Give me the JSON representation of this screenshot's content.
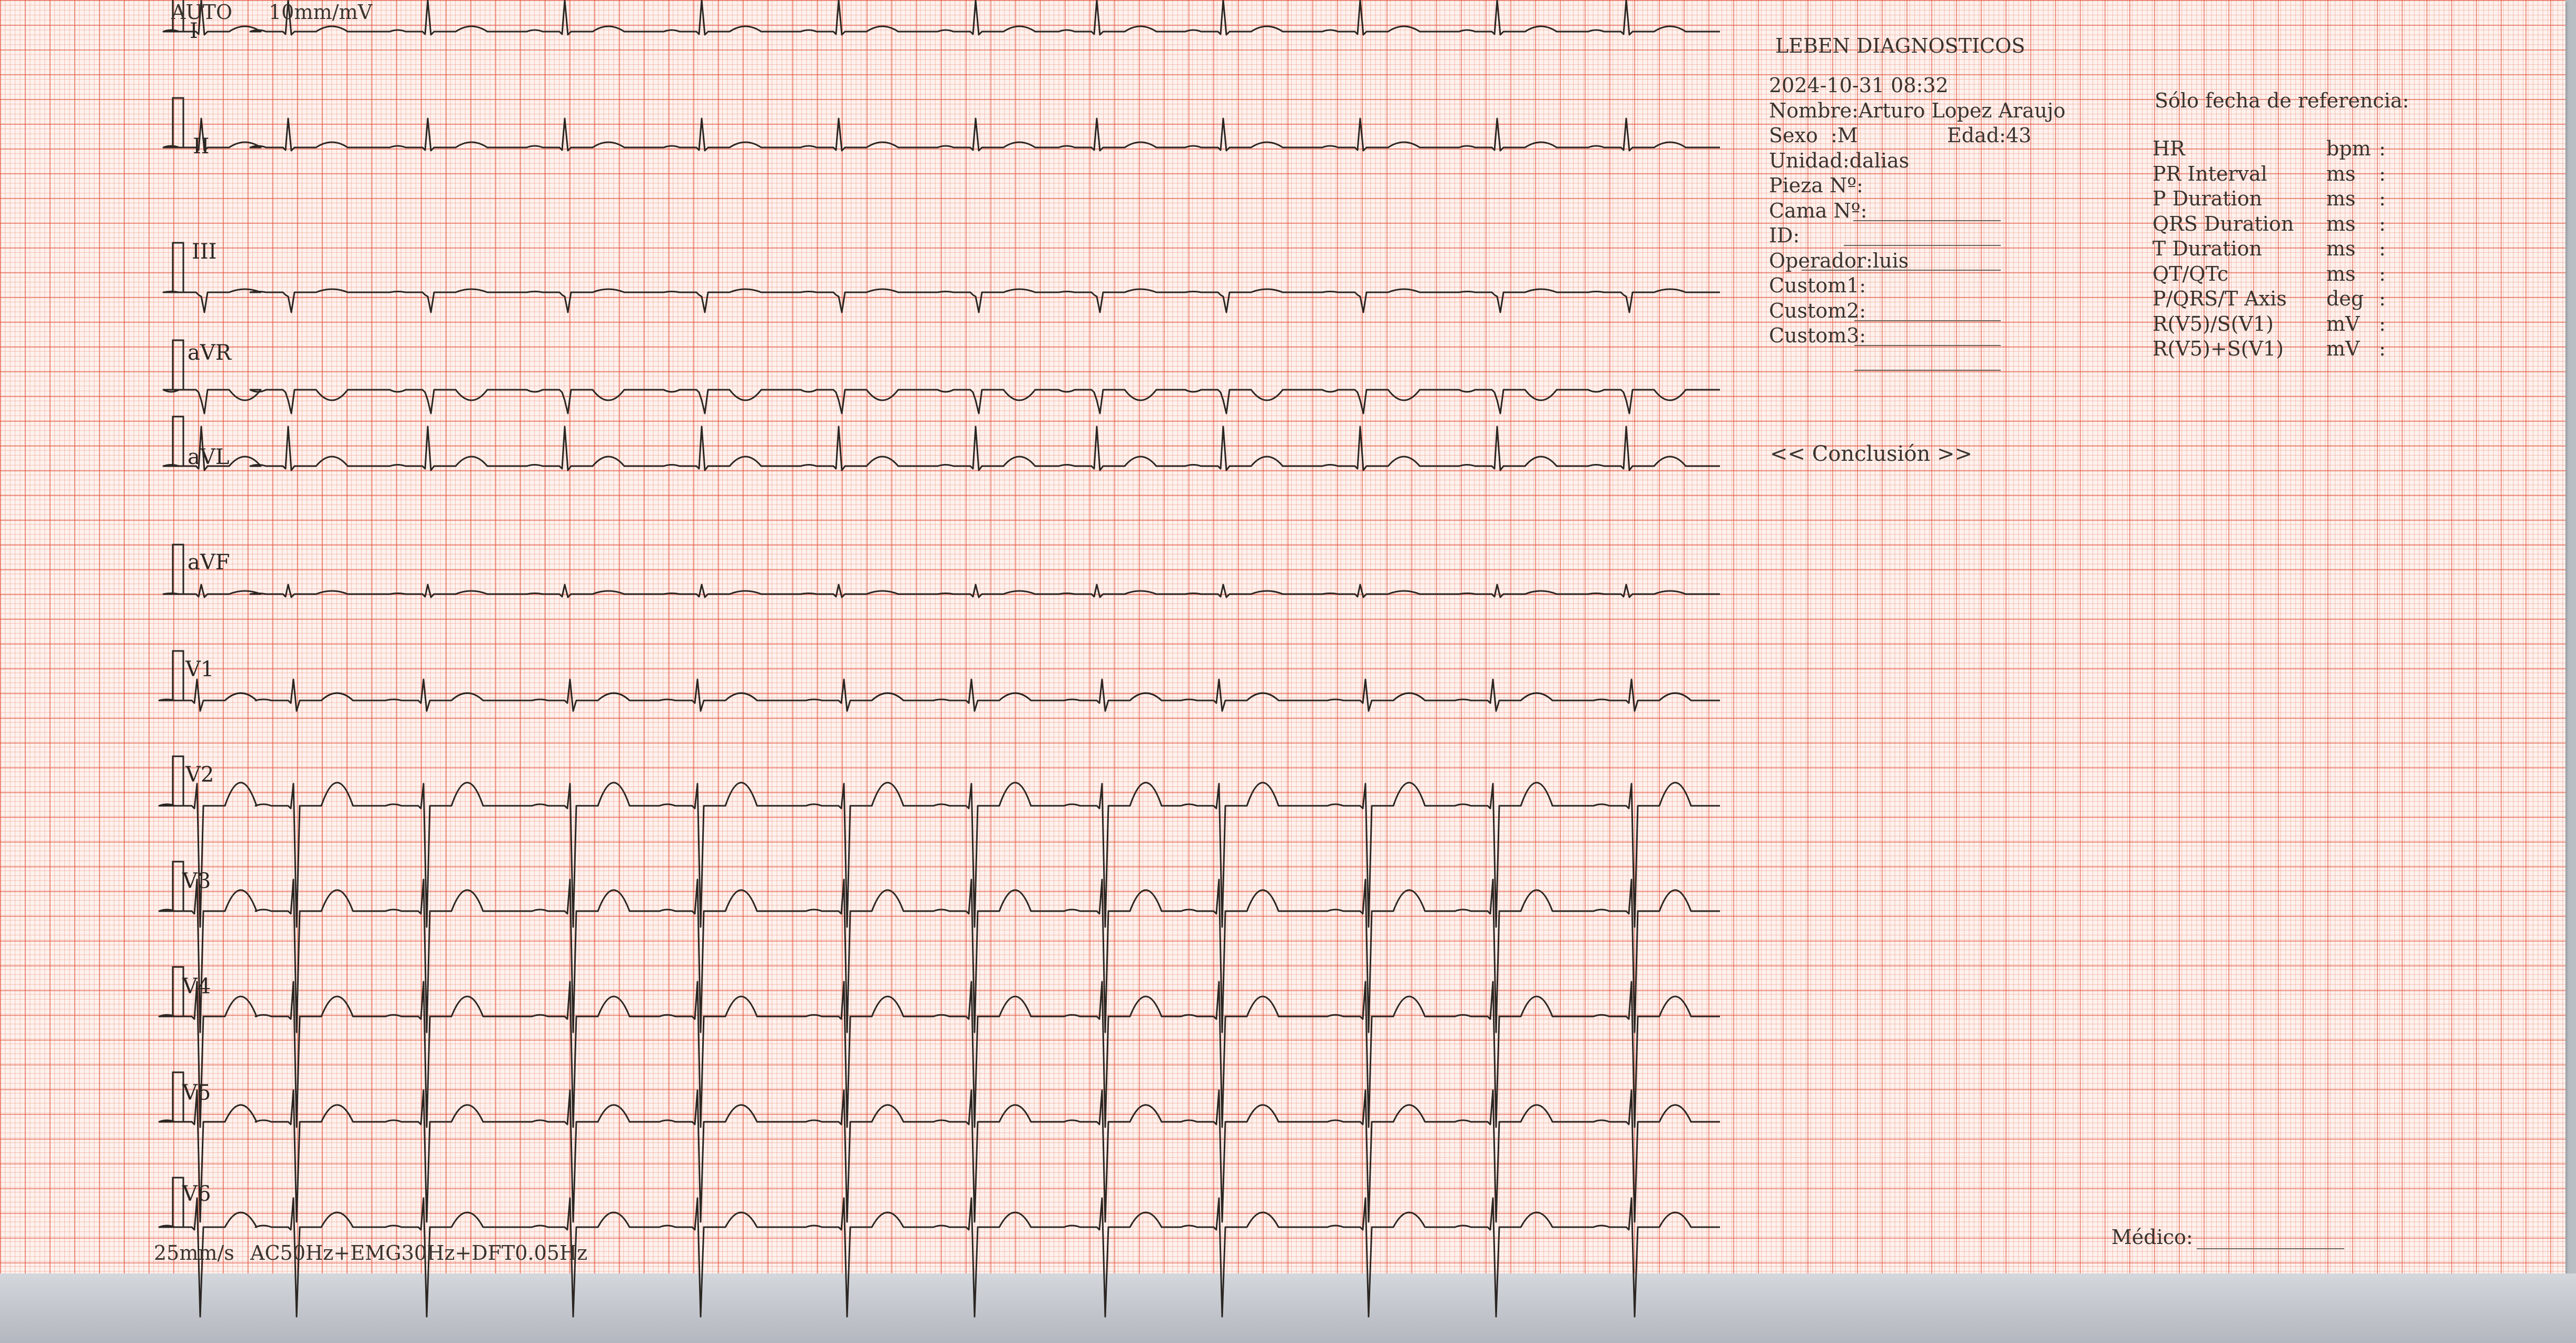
{
  "header": {
    "mode": "AUTO",
    "gain": "10mm/mV"
  },
  "leads": [
    "I",
    "II",
    "III",
    "aVR",
    "aVL",
    "aVF",
    "V1",
    "V2",
    "V3",
    "V4",
    "V5",
    "V6"
  ],
  "footer": {
    "speed": "25mm/s",
    "filters": "AC50Hz+EMG30Hz+DFT0.05Hz"
  },
  "patient": {
    "clinic": "LEBEN DIAGNOSTICOS",
    "datetime": "2024-10-31 08:32",
    "name": "Nombre:Arturo Lopez Araujo",
    "sex": "Sexo  :M",
    "age": "Edad:43",
    "unit": "Unidad:dalias",
    "room": "Pieza Nº:",
    "bed": "Cama Nº:",
    "id": "ID:",
    "operator": "Operador:luis",
    "custom1": "Custom1:",
    "custom2": "Custom2:",
    "custom3": "Custom3:"
  },
  "measurements": {
    "title": "Sólo fecha de referencia:",
    "rows": [
      {
        "label": "HR",
        "unit": "bpm",
        "colon": ":"
      },
      {
        "label": "PR Interval",
        "unit": "ms",
        "colon": ":"
      },
      {
        "label": "P Duration",
        "unit": "ms",
        "colon": ":"
      },
      {
        "label": "QRS Duration",
        "unit": "ms",
        "colon": ":"
      },
      {
        "label": "T Duration",
        "unit": "ms",
        "colon": ":"
      },
      {
        "label": "QT/QTc",
        "unit": "ms",
        "colon": ":"
      },
      {
        "label": "P/QRS/T Axis",
        "unit": "deg",
        "colon": ":"
      },
      {
        "label": "R(V5)/S(V1)",
        "unit": "mV",
        "colon": ":"
      },
      {
        "label": "R(V5)+S(V1)",
        "unit": "mV",
        "colon": ":"
      }
    ]
  },
  "conclusion": "<< Conclusión >>",
  "doctor": "Médico:",
  "colors": {
    "paper": "#fdf2ee",
    "grid_major": "#e24e36",
    "grid_minor": "#ec7864",
    "trace": "#2b2622"
  }
}
